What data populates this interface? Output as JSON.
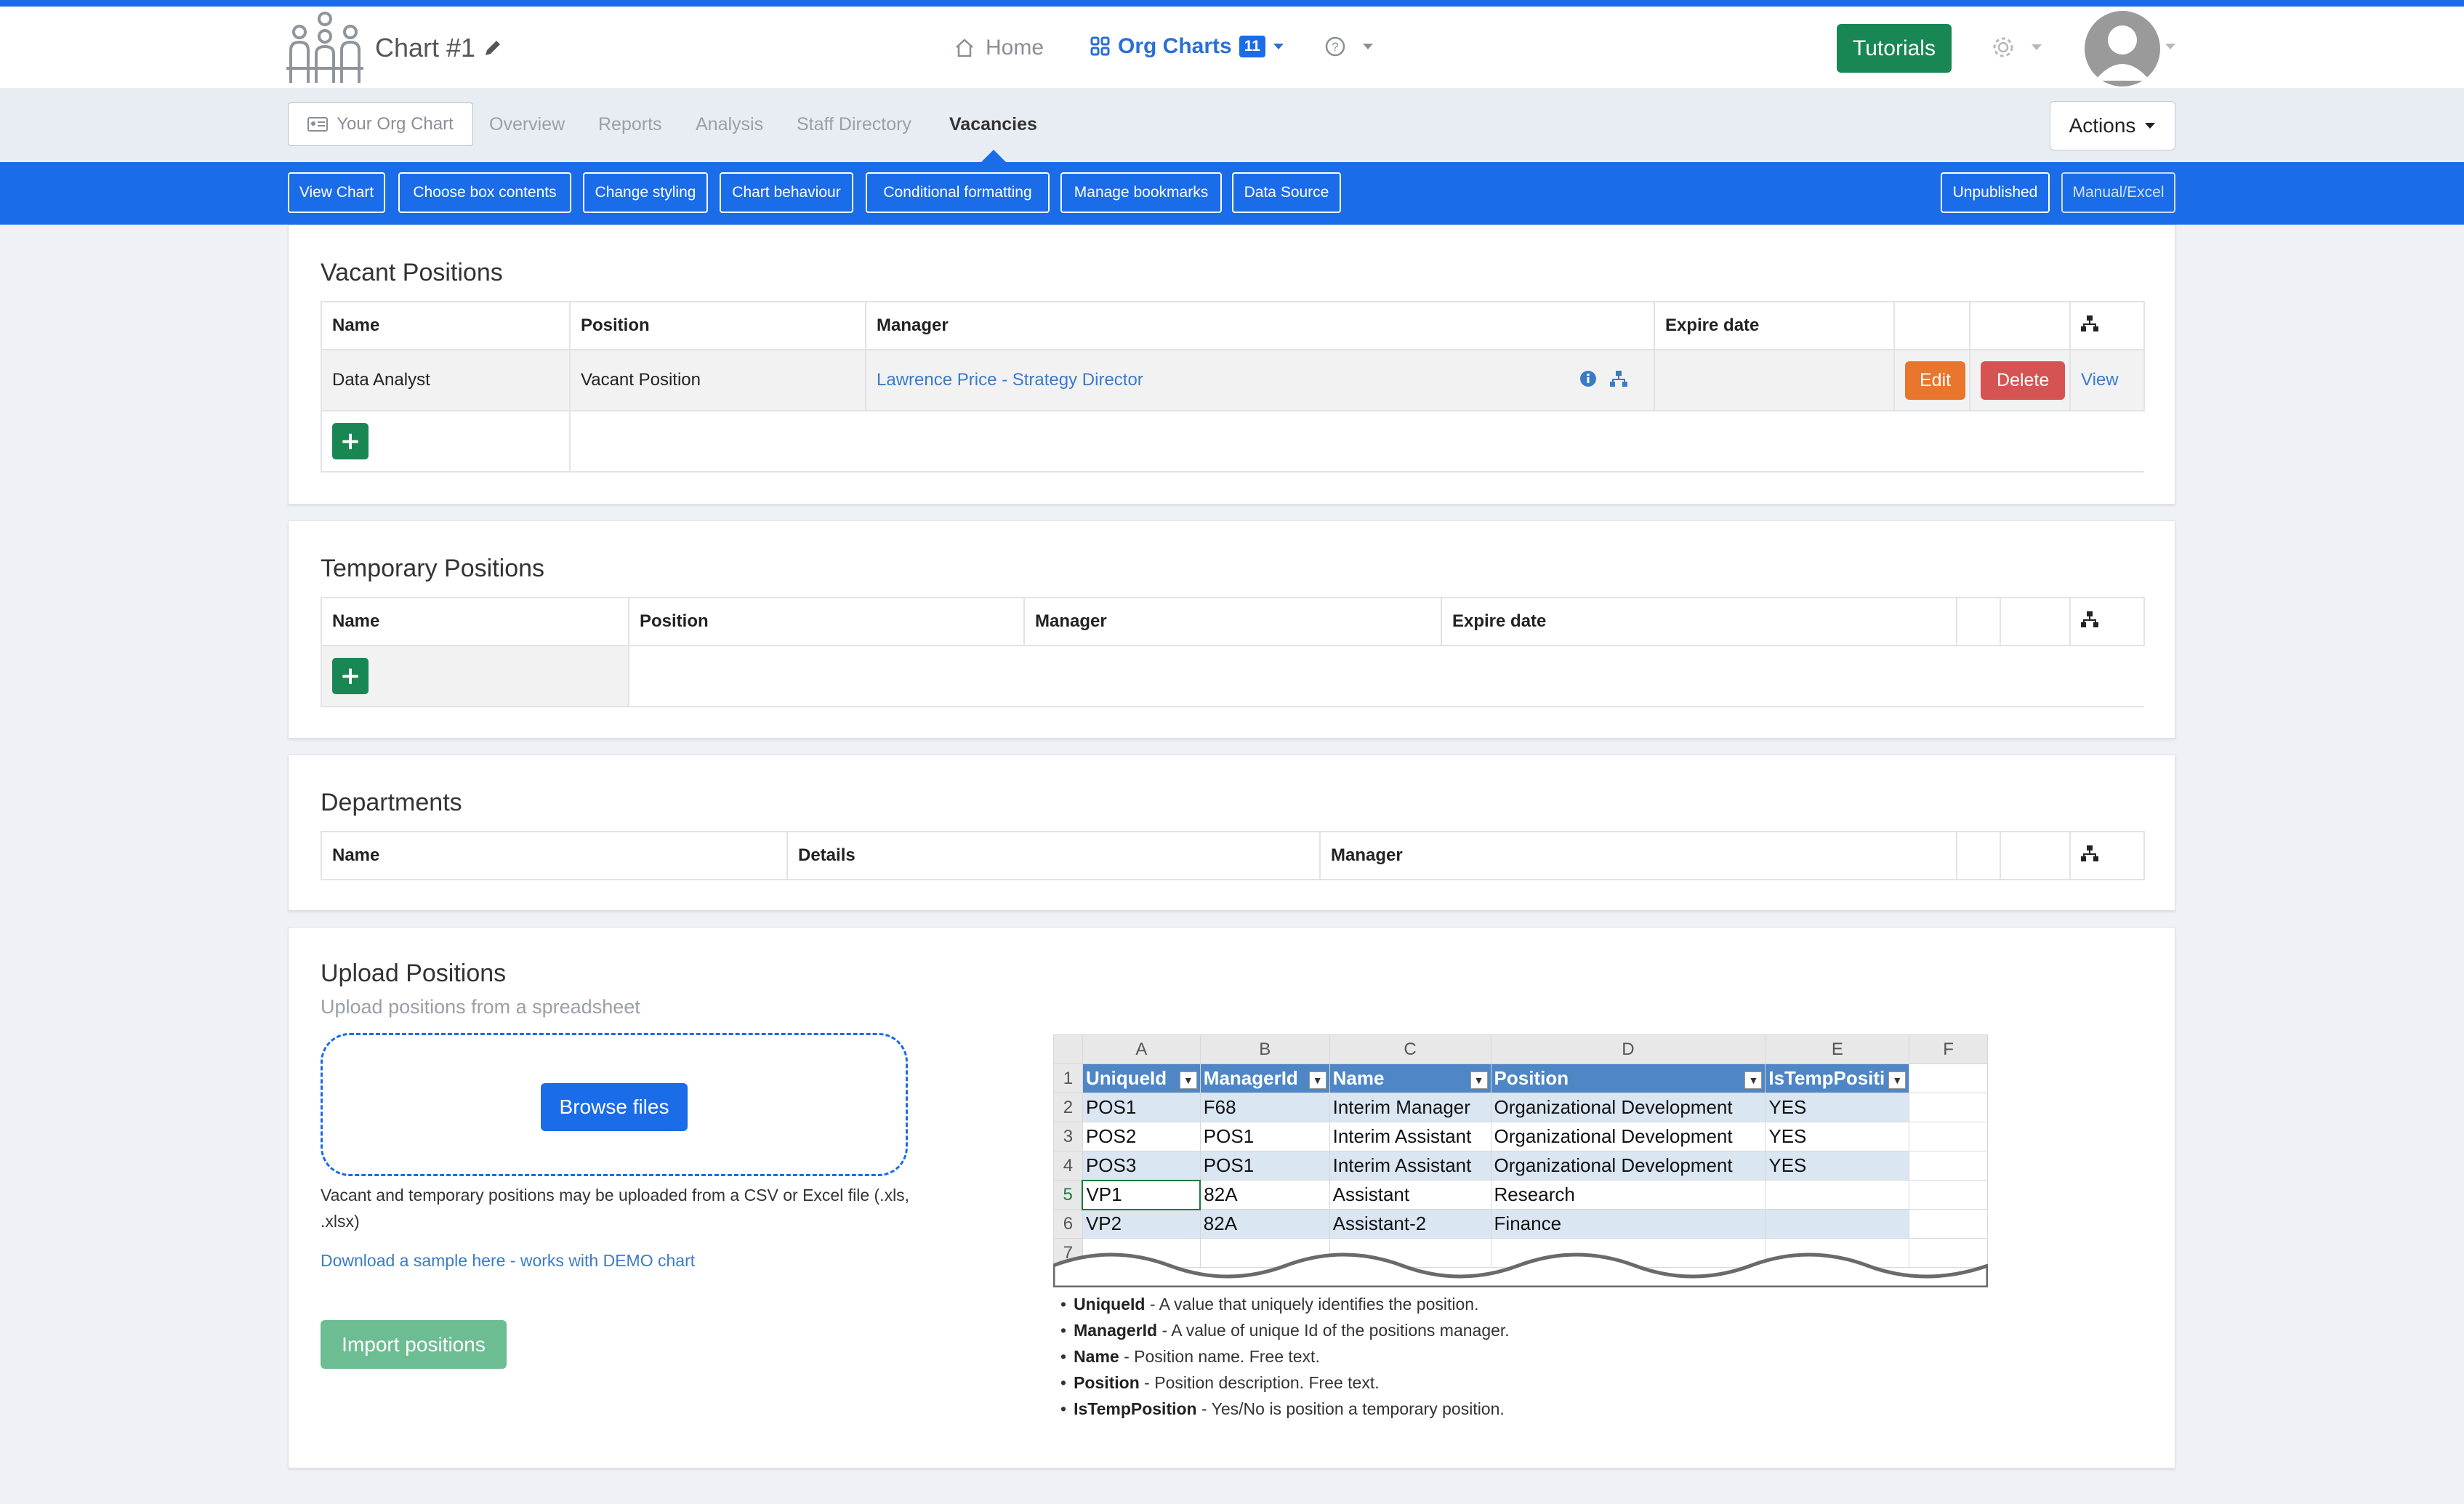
{
  "header": {
    "chart_title": "Chart #1",
    "nav_home": "Home",
    "nav_org_charts": "Org Charts",
    "org_charts_count": "11",
    "tutorials_label": "Tutorials"
  },
  "subnav": {
    "your_org_chart": "Your Org Chart",
    "tabs": [
      "Overview",
      "Reports",
      "Analysis",
      "Staff Directory",
      "Vacancies"
    ],
    "active_tab": "Vacancies",
    "actions_label": "Actions"
  },
  "toolbar": {
    "buttons": [
      "View Chart",
      "Choose box contents",
      "Change styling",
      "Chart behaviour",
      "Conditional formatting",
      "Manage bookmarks",
      "Data Source"
    ],
    "status_buttons": [
      "Unpublished",
      "Manual/Excel"
    ]
  },
  "vacant": {
    "title": "Vacant Positions",
    "columns": [
      "Name",
      "Position",
      "Manager",
      "Expire date"
    ],
    "rows": [
      {
        "name": "Data Analyst",
        "position": "Vacant Position",
        "manager": "Lawrence Price - Strategy Director",
        "expire_date": "",
        "edit": "Edit",
        "delete": "Delete",
        "view": "View"
      }
    ]
  },
  "temporary": {
    "title": "Temporary Positions",
    "columns": [
      "Name",
      "Position",
      "Manager",
      "Expire date"
    ]
  },
  "departments": {
    "title": "Departments",
    "columns": [
      "Name",
      "Details",
      "Manager"
    ]
  },
  "upload": {
    "title": "Upload Positions",
    "subtitle": "Upload positions from a spreadsheet",
    "browse_label": "Browse files",
    "note": "Vacant and temporary positions may be uploaded from a CSV or Excel file (.xls, .xlsx)",
    "sample_link": "Download a sample here - works with DEMO chart",
    "import_label": "Import positions",
    "sheet": {
      "col_letters": [
        "A",
        "B",
        "C",
        "D",
        "E",
        "F"
      ],
      "row_numbers": [
        "1",
        "2",
        "3",
        "4",
        "5",
        "6",
        "7"
      ],
      "headers": [
        "UniqueId",
        "ManagerId",
        "Name",
        "Position",
        "IsTempPositi"
      ],
      "rows": [
        [
          "POS1",
          "F68",
          "Interim Manager",
          "Organizational Development",
          "YES"
        ],
        [
          "POS2",
          "POS1",
          "Interim Assistant",
          "Organizational Development",
          "YES"
        ],
        [
          "POS3",
          "POS1",
          "Interim Assistant",
          "Organizational Development",
          "YES"
        ],
        [
          "VP1",
          "82A",
          "Assistant",
          "Research",
          ""
        ],
        [
          "VP2",
          "82A",
          "Assistant-2",
          "Finance",
          ""
        ]
      ]
    },
    "fields": [
      {
        "name": "UniqueId",
        "desc": " - A value that uniquely identifies the position."
      },
      {
        "name": "ManagerId",
        "desc": " - A value of unique Id of the positions manager."
      },
      {
        "name": "Name",
        "desc": " - Position name. Free text."
      },
      {
        "name": "Position",
        "desc": " - Position description. Free text."
      },
      {
        "name": "IsTempPosition",
        "desc": " - Yes/No is position a temporary position."
      }
    ]
  },
  "colors": {
    "brand_blue": "#1a6ce8",
    "success_green": "#198754",
    "edit_orange": "#e8762c",
    "delete_red": "#d65353",
    "excel_header_blue": "#4f86c6"
  }
}
